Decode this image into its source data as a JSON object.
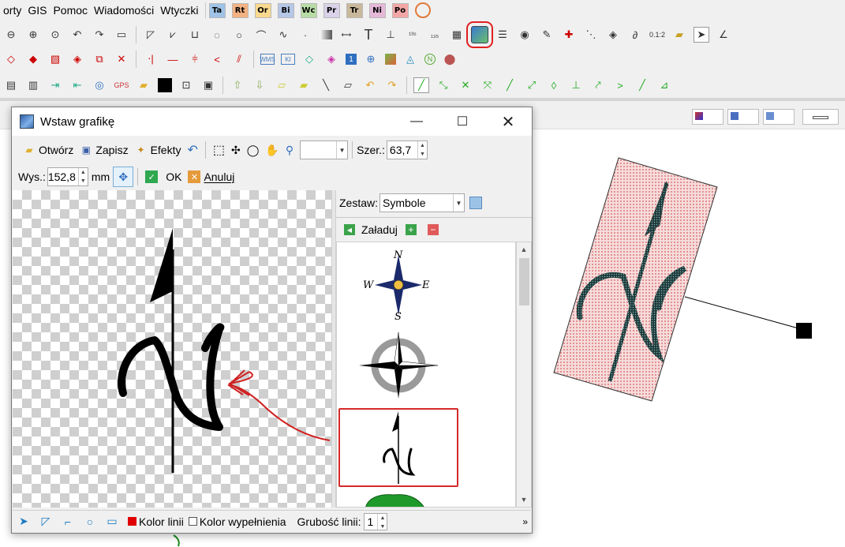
{
  "menu": {
    "items": [
      "orty",
      "GIS",
      "Pomoc",
      "Wiadomości",
      "Wtyczki"
    ]
  },
  "doc_tags": [
    "Ta",
    "Rt",
    "Or",
    "Bi",
    "Wc",
    "Pr",
    "Tr",
    "Ni",
    "Po"
  ],
  "doc_tag_colors": [
    "#9fc3e6",
    "#f4b183",
    "#f9d98e",
    "#b4c7e7",
    "#b7dca6",
    "#d9d2e9",
    "#c9b89b",
    "#e6b8d8",
    "#f4a6a6"
  ],
  "toolbar": {
    "insert_graphic_highlight_color": "#e02020",
    "icons_row1": [
      "zoom-out-icon",
      "zoom-in-icon",
      "zoom-window-icon",
      "zoom-prev-icon",
      "zoom-next-icon",
      "zoom-all-icon",
      "polyline-icon",
      "polygon-icon",
      "line-icon",
      "circle-icon",
      "ellipse-icon",
      "arc-icon",
      "curve-icon",
      "point-icon",
      "gradient-icon",
      "dimension-icon",
      "text-icon",
      "label-icon",
      "label2-icon",
      "label3-icon",
      "table-icon",
      "insert-graphic-icon",
      "list-icon",
      "fill-icon",
      "brush-icon",
      "cross-icon",
      "dots-icon",
      "diamond-icon",
      "curve2-icon",
      "scale-icon",
      "eraser-icon",
      "select-arrow-icon",
      "angle-icon"
    ],
    "gis_markers": [
      "WMS",
      "KI"
    ]
  },
  "dialog": {
    "title": "Wstaw grafikę",
    "open_label": "Otwórz",
    "save_label": "Zapisz",
    "effects_label": "Efekty",
    "width_label": "Szer.:",
    "width_value": "63,7",
    "height_label": "Wys.:",
    "height_value": "152,8",
    "unit": "mm",
    "ok_label": "OK",
    "cancel_label": "Anuluj",
    "set_label": "Zestaw:",
    "set_value": "Symbole",
    "load_label": "Załaduj",
    "symbols": [
      {
        "name": "compass-rose-color",
        "letters": [
          "N",
          "E",
          "S",
          "W"
        ]
      },
      {
        "name": "compass-rose-gray"
      },
      {
        "name": "north-arrow-n",
        "selected": true
      },
      {
        "name": "tree-symbol"
      }
    ],
    "status": {
      "line_color_label": "Kolor linii",
      "line_color": "#e00000",
      "fill_color_label": "Kolor wypełnienia",
      "thickness_label": "Grubość linii:",
      "thickness_value": "1"
    }
  },
  "canvas": {
    "placed_symbol_fill": "#f2c6c6",
    "selected_frame_color": "#cc0000"
  }
}
